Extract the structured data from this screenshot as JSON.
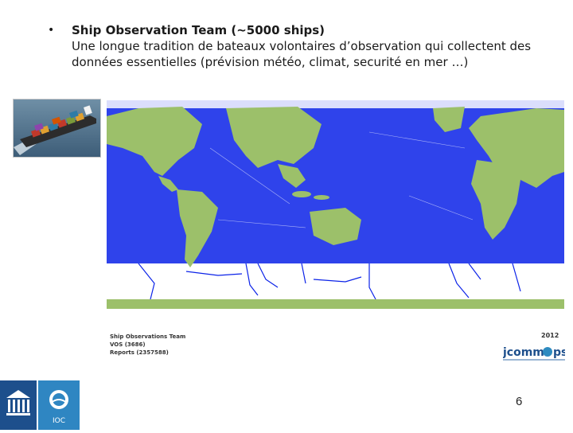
{
  "slide": {
    "bullet_symbol": "•",
    "heading": "Ship Observation Team (~5000 ships)",
    "body_line1": "Une longue tradition de bateaux volontaires d’observation qui collectent des",
    "body_line2": "données essentielles (prévision météo, climat, securité en mer …)",
    "page_number": "6"
  },
  "map": {
    "caption_line1": "Ship Observations Team",
    "caption_line2": "VOS (3686)",
    "caption_line3": "Reports (2357588)",
    "year": "2012",
    "logo_text_1": "jcomm",
    "logo_text_2": "ps",
    "colors": {
      "land": "#9cc06a",
      "tracks": "#0b22e8",
      "ocean": "#ffffff"
    }
  },
  "footer": {
    "logo_left": "unesco-logo",
    "logo_right": "ioc-logo",
    "ioc_text": "IOC"
  }
}
